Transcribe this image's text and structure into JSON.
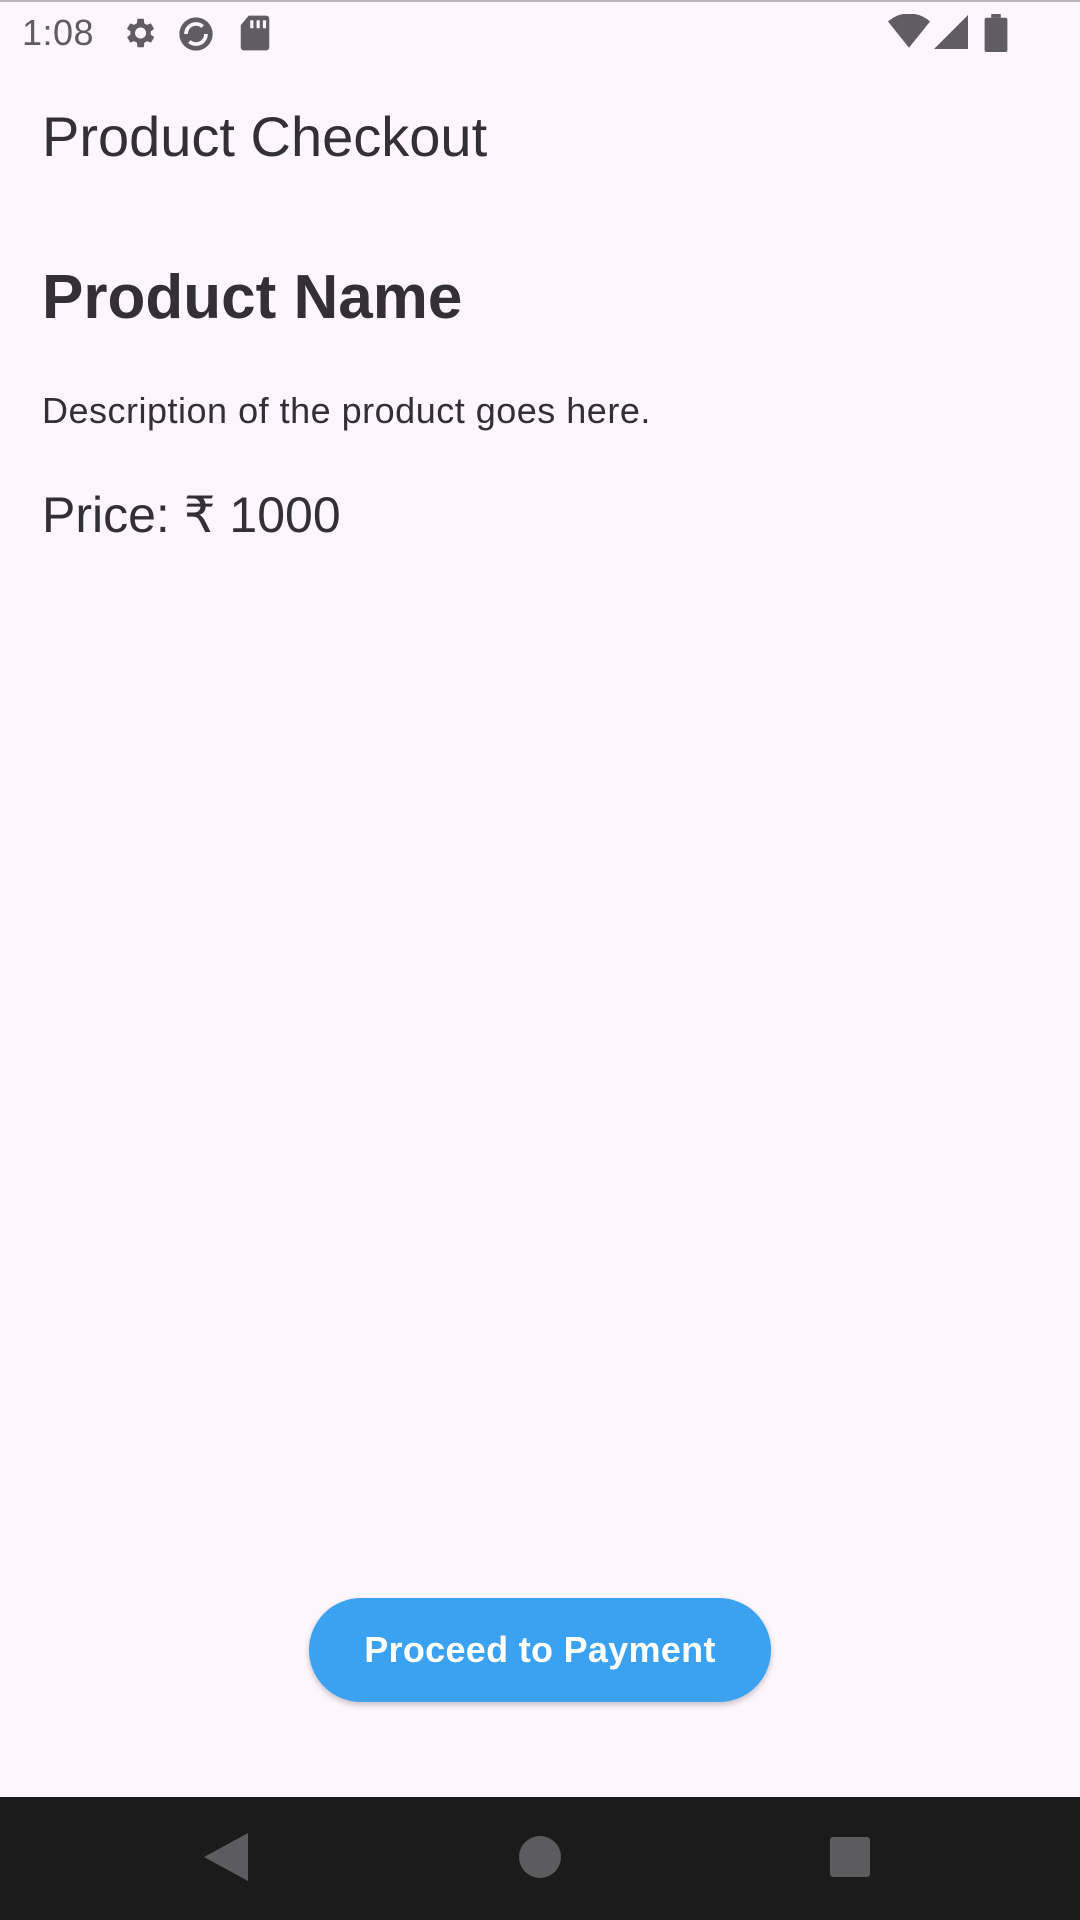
{
  "status_bar": {
    "time": "1:08",
    "icons": [
      "settings-icon",
      "sync-app-icon",
      "sd-card-icon",
      "wifi-icon",
      "cell-signal-icon",
      "battery-icon"
    ]
  },
  "app_bar": {
    "title": "Product Checkout"
  },
  "product": {
    "name": "Product Name",
    "description": "Description of the product goes here.",
    "price_text": "Price: ₹ 1000"
  },
  "actions": {
    "pay_label": "Proceed to Payment"
  },
  "nav_bar": {
    "buttons": [
      "back-icon",
      "home-icon",
      "recents-icon"
    ]
  },
  "colors": {
    "background": "#fdf7fd",
    "text": "#322f37",
    "button": "#3aa2f1",
    "nav_bar": "#1b1b1c"
  }
}
